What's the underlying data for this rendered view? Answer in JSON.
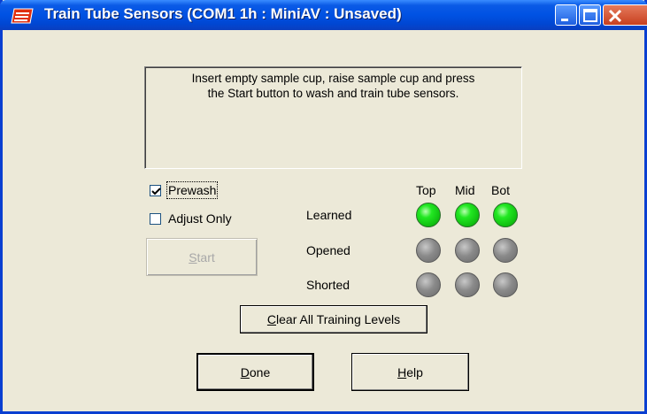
{
  "window": {
    "title": "Train Tube Sensors (COM1 1h : MiniAV : Unsaved)"
  },
  "message": {
    "line1": "Insert empty sample cup, raise sample cup and press",
    "line2": "the Start button to wash and train tube sensors."
  },
  "options": {
    "prewash": {
      "label": "Prewash",
      "checked": true
    },
    "adjust_only": {
      "label": "Adjust Only",
      "checked": false
    }
  },
  "buttons": {
    "start": {
      "label": "Start",
      "mnemonic": "S",
      "rest": "tart",
      "enabled": false
    },
    "clear": {
      "label": "Clear All Training Levels",
      "mnemonic": "C",
      "rest": "lear All Training Levels"
    },
    "done": {
      "label": "Done",
      "mnemonic": "D",
      "rest": "one"
    },
    "help": {
      "label": "Help",
      "mnemonic": "H",
      "rest": "elp"
    }
  },
  "sensors": {
    "columns": [
      "Top",
      "Mid",
      "Bot"
    ],
    "rows": [
      {
        "label": "Learned",
        "states": [
          "on",
          "on",
          "on"
        ]
      },
      {
        "label": "Opened",
        "states": [
          "off",
          "off",
          "off"
        ]
      },
      {
        "label": "Shorted",
        "states": [
          "off",
          "off",
          "off"
        ]
      }
    ],
    "on_color": "#22e822",
    "off_color": "#8a8a8a"
  },
  "icons": {
    "app": "app-logo-icon",
    "minimize": "minimize-icon",
    "maximize": "maximize-icon",
    "close": "close-icon",
    "checkmark": "checkmark-icon"
  }
}
